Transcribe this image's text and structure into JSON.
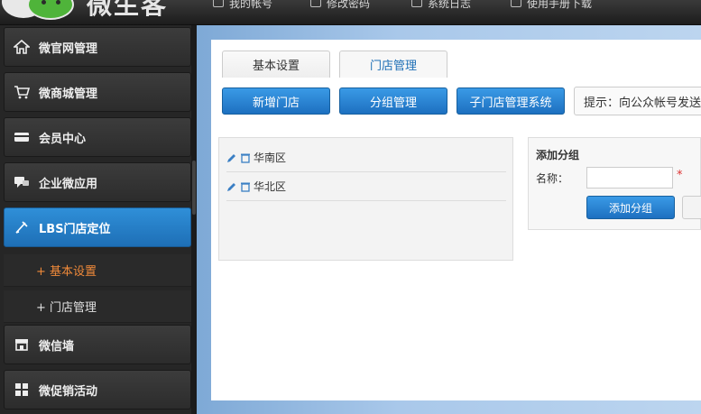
{
  "header": {
    "app_title": "微生客",
    "nav": [
      {
        "label": "我的帐号",
        "icon": "user-icon"
      },
      {
        "label": "修改密码",
        "icon": "edit-icon"
      },
      {
        "label": "系统日志",
        "icon": "list-icon"
      },
      {
        "label": "使用手册下载",
        "icon": "document-icon"
      }
    ]
  },
  "sidebar": {
    "items": [
      {
        "label": "微官网管理",
        "icon": "home-icon"
      },
      {
        "label": "微商城管理",
        "icon": "cart-icon"
      },
      {
        "label": "会员中心",
        "icon": "card-icon"
      },
      {
        "label": "企业微应用",
        "icon": "chat-icon"
      },
      {
        "label": "LBS门店定位",
        "icon": "pin-icon",
        "active": true
      },
      {
        "label": "微信墙",
        "icon": "store-icon"
      },
      {
        "label": "微促销活动",
        "icon": "grid-icon"
      }
    ],
    "sub_items": [
      {
        "label": "+ 基本设置",
        "current": true
      },
      {
        "label": "+ 门店管理",
        "current": false
      }
    ]
  },
  "main": {
    "tabs": [
      {
        "label": "基本设置",
        "active": false
      },
      {
        "label": "门店管理",
        "active": true
      }
    ],
    "buttons": {
      "add_store": "新增门店",
      "group_manage": "分组管理",
      "sub_store_system": "子门店管理系统"
    },
    "tip": "提示：向公众帐号发送",
    "groups": [
      "华南区",
      "华北区"
    ],
    "add_group": {
      "heading": "添加分组",
      "name_label": "名称：",
      "name_value": "",
      "required_mark": "*",
      "submit_label": "添加分组"
    }
  },
  "colors": {
    "accent": "#1e6fb6",
    "active_sub": "#f08a3a",
    "brand_green": "#4fb43a"
  }
}
